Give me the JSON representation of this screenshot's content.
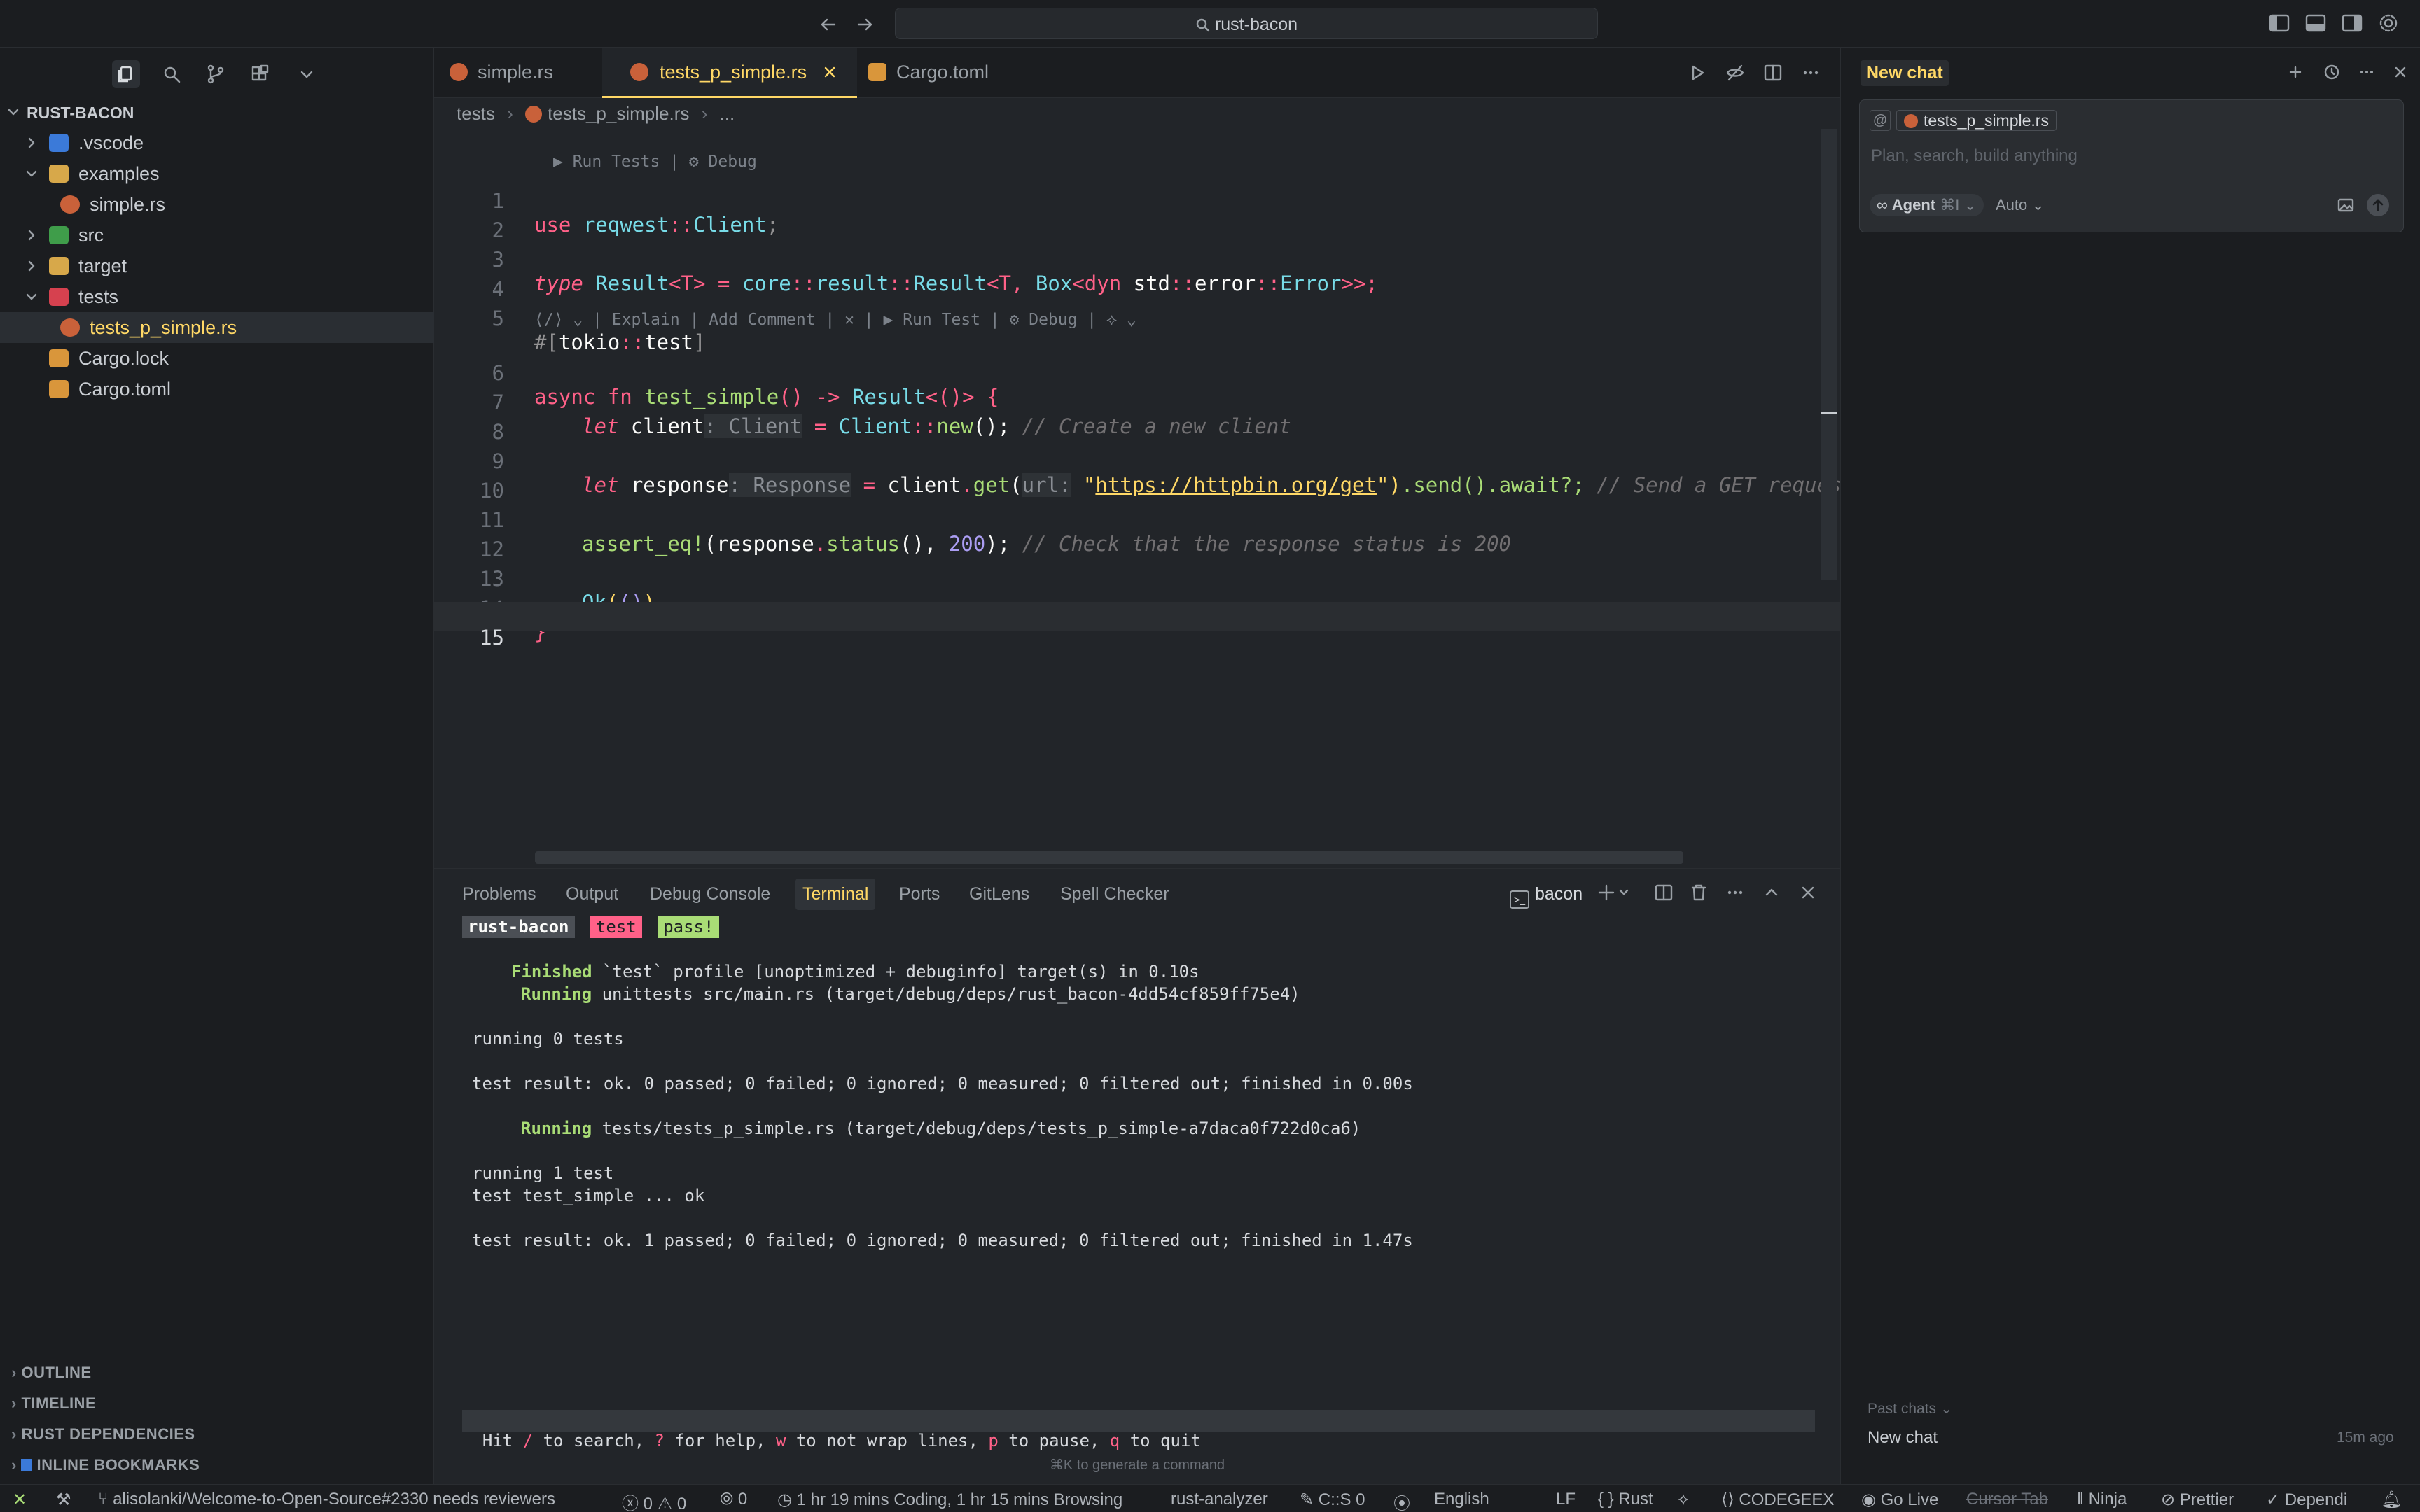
{
  "titlebar": {
    "search_text": "rust-bacon"
  },
  "explorer": {
    "root_label": "RUST-BACON",
    "items": [
      {
        "label": ".vscode"
      },
      {
        "label": "examples"
      },
      {
        "label": "simple.rs"
      },
      {
        "label": "src"
      },
      {
        "label": "target"
      },
      {
        "label": "tests"
      },
      {
        "label": "tests_p_simple.rs"
      },
      {
        "label": "Cargo.lock"
      },
      {
        "label": "Cargo.toml"
      }
    ],
    "sections": [
      "OUTLINE",
      "TIMELINE",
      "RUST DEPENDENCIES",
      "INLINE BOOKMARKS"
    ]
  },
  "tabs": [
    {
      "label": "simple.rs"
    },
    {
      "label": "tests_p_simple.rs"
    },
    {
      "label": "Cargo.toml"
    }
  ],
  "breadcrumb": {
    "folder": "tests",
    "file": "tests_p_simple.rs",
    "more": "..."
  },
  "codelens": {
    "top": "▶ Run Tests | ⚙ Debug",
    "fn": "| Explain | Add Comment |  ✕  | ▶ Run Test | ⚙ Debug |"
  },
  "code": {
    "line_numbers": [
      "1",
      "2",
      "3",
      "4",
      "5",
      "6",
      "7",
      "8",
      "9",
      "10",
      "11",
      "12",
      "13",
      "14",
      "15"
    ],
    "l1": [
      "use ",
      "reqwest",
      "::",
      "Client",
      ";"
    ],
    "l3": [
      "type ",
      "Result",
      "<T>",
      " = ",
      "core",
      "::",
      "result",
      "::",
      "Result",
      "<T, ",
      "Box",
      "<",
      "dyn ",
      "std",
      "::",
      "error",
      "::",
      "Error",
      ">>;"
    ],
    "l5": [
      "#[",
      "tokio",
      "::",
      "test",
      "]"
    ],
    "l6": [
      "async fn ",
      "test_simple",
      "() -> ",
      "Result",
      "<()> {"
    ],
    "l7": [
      "let ",
      "client",
      ": Client",
      " = ",
      "Client",
      "::",
      "new",
      "(); ",
      "// Create a new client"
    ],
    "l9": [
      "let ",
      "response",
      ": Response",
      " = ",
      "client",
      ".",
      "get",
      "(",
      "url:",
      " \"",
      "https://httpbin.org/get",
      "\")",
      ".send().await?; ",
      "// Send a GET request to"
    ],
    "l11": [
      "assert_eq!",
      "(",
      "response",
      ".",
      "status",
      "(), ",
      "200",
      "); ",
      "// Check that the response status is 200"
    ],
    "l13": [
      "Ok",
      "(",
      "()",
      ")"
    ],
    "l14": [
      "}"
    ]
  },
  "panel": {
    "tabs": [
      "Problems",
      "Output",
      "Debug Console",
      "Terminal",
      "Ports",
      "GitLens",
      "Spell Checker"
    ],
    "terminal_name": "bacon",
    "badges": [
      "rust-bacon",
      "test",
      "pass!"
    ],
    "lines": {
      "finished_kw": "Finished",
      "finished_rest": " `test` profile [unoptimized + debuginfo] target(s) in 0.10s",
      "running1_kw": "Running",
      "running1_rest": " unittests src/main.rs (target/debug/deps/rust_bacon-4dd54cf859ff75e4)",
      "running0": "running 0 tests",
      "result0": "test result: ok. 0 passed; 0 failed; 0 ignored; 0 measured; 0 filtered out; finished in 0.00s",
      "running2_kw": "Running",
      "running2_rest": " tests/tests_p_simple.rs (target/debug/deps/tests_p_simple-a7daca0f722d0ca6)",
      "running_one": "running 1 test",
      "test_simple": "test test_simple ... ok",
      "result1": "test result: ok. 1 passed; 0 failed; 0 ignored; 0 measured; 0 filtered out; finished in 1.47s"
    },
    "help": [
      {
        "t": "Hit ",
        "k": false
      },
      {
        "t": "/",
        "k": true
      },
      {
        "t": " to search, ",
        "k": false
      },
      {
        "t": "?",
        "k": true
      },
      {
        "t": " for help, ",
        "k": false
      },
      {
        "t": "w",
        "k": true
      },
      {
        "t": " to not wrap lines, ",
        "k": false
      },
      {
        "t": "p",
        "k": true
      },
      {
        "t": " to pause, ",
        "k": false
      },
      {
        "t": "q",
        "k": true
      },
      {
        "t": " to quit",
        "k": false
      }
    ],
    "generate_hint": "⌘K to generate a command"
  },
  "chat": {
    "title": "New chat",
    "context_file": "tests_p_simple.rs",
    "placeholder": "Plan, search, build anything",
    "agent_label": "Agent",
    "agent_shortcut": "⌘I",
    "model": "Auto",
    "past_chats_label": "Past chats",
    "past_chat_name": "New chat",
    "past_chat_time": "15m ago"
  },
  "statusbar": {
    "branch": "alisolanki/Welcome-to-Open-Source#2330 needs reviewers",
    "errors": "0",
    "warnings": "0",
    "ports": "0",
    "time": "1 hr 19 mins Coding, 1 hr 15 mins Browsing",
    "analyzer": "rust-analyzer",
    "cs": "C::S 0",
    "lang_ui": "English",
    "eol": "LF",
    "lang": "Rust",
    "codegeex": "CODEGEEX",
    "golive": "Go Live",
    "cursor_tab": "Cursor Tab",
    "ninja": "Ninja",
    "prettier": "Prettier",
    "dependi": "Dependi"
  },
  "colors": {
    "keyword": "#ff6188",
    "type": "#78dce8",
    "function": "#a9dc76",
    "string": "#ffd866",
    "number": "#ab9df2",
    "comment": "#727072",
    "accent": "#ffd866"
  }
}
